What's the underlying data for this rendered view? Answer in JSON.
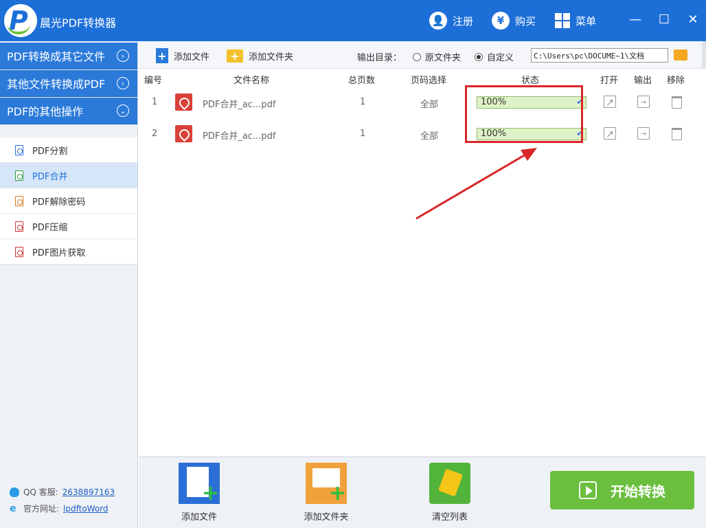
{
  "app": {
    "title": "晨光PDF转换器"
  },
  "titlebar": {
    "register": "注册",
    "buy": "购买",
    "menu": "菜单",
    "buy_symbol": "¥",
    "minimize": "—",
    "maximize": "☐",
    "close": "✕"
  },
  "sidebar": {
    "categories": [
      {
        "label": "PDF转换成其它文件",
        "chevron": "›"
      },
      {
        "label": "其他文件转换成PDF",
        "chevron": "›"
      },
      {
        "label": "PDF的其他操作",
        "chevron": "⌄"
      }
    ],
    "items": [
      {
        "label": "PDF分割"
      },
      {
        "label": "PDF合并"
      },
      {
        "label": "PDF解除密码"
      },
      {
        "label": "PDF压缩"
      },
      {
        "label": "PDF图片获取"
      }
    ],
    "qq_label": "QQ 客服:",
    "qq_value": "2638897163",
    "site_label": "官方网址:",
    "site_value": "lpdftoWord"
  },
  "toolbar": {
    "add_file": "添加文件",
    "add_folder": "添加文件夹",
    "output_label": "输出目录：",
    "radio_original": "原文件夹",
    "radio_custom": "自定义",
    "output_path": "C:\\Users\\pc\\DOCUME~1\\文档"
  },
  "table": {
    "headers": {
      "no": "编号",
      "name": "文件名称",
      "pages": "总页数",
      "page_select": "页码选择",
      "status": "状态",
      "open": "打开",
      "output": "输出",
      "remove": "移除"
    },
    "rows": [
      {
        "no": "1",
        "name": "PDF合并_ac...pdf",
        "pages": "1",
        "page_select": "全部",
        "status": "100%"
      },
      {
        "no": "2",
        "name": "PDF合并_ac...pdf",
        "pages": "1",
        "page_select": "全部",
        "status": "100%"
      }
    ]
  },
  "bottom": {
    "add_file": "添加文件",
    "add_folder": "添加文件夹",
    "clear_list": "清空列表",
    "start": "开始转换"
  },
  "colors": {
    "titlebar": "#1d6fd8",
    "category": "#2b7ad9",
    "progress": "#dff2c7",
    "highlight": "#d92626",
    "start": "#6abf3e"
  }
}
